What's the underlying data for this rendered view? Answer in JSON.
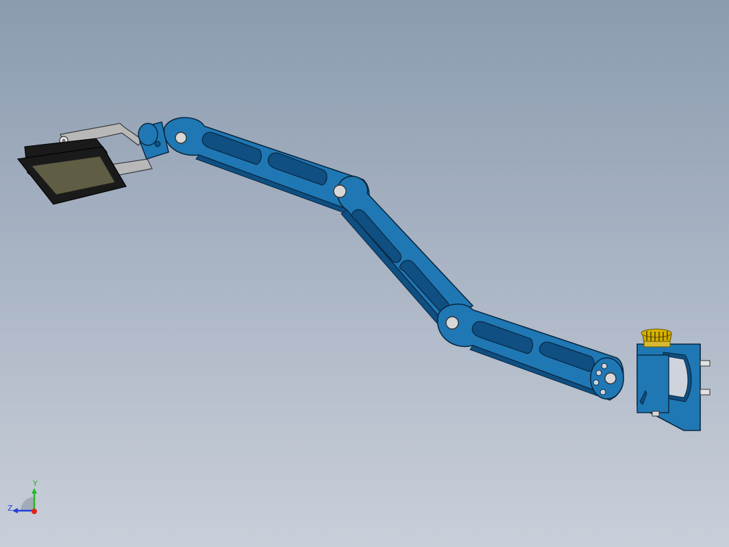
{
  "viewport": {
    "background_top": "#8b9bb0",
    "background_bottom": "#c9cfd9"
  },
  "model": {
    "part_color": "#1f78b4",
    "part_dark": "#0f4f82",
    "part_edge": "#0a2740",
    "pin_color": "#d7d7d7",
    "bracket_color": "#b8b8b8",
    "lamp_housing_color": "#1a1a1a",
    "lamp_lens_color": "#5f5e44",
    "knob_color": "#d4b000"
  },
  "triad": {
    "x_color": "#e0231d",
    "y_color": "#26b526",
    "z_color": "#2540d8",
    "y_label": "Y",
    "z_label": "Z"
  }
}
